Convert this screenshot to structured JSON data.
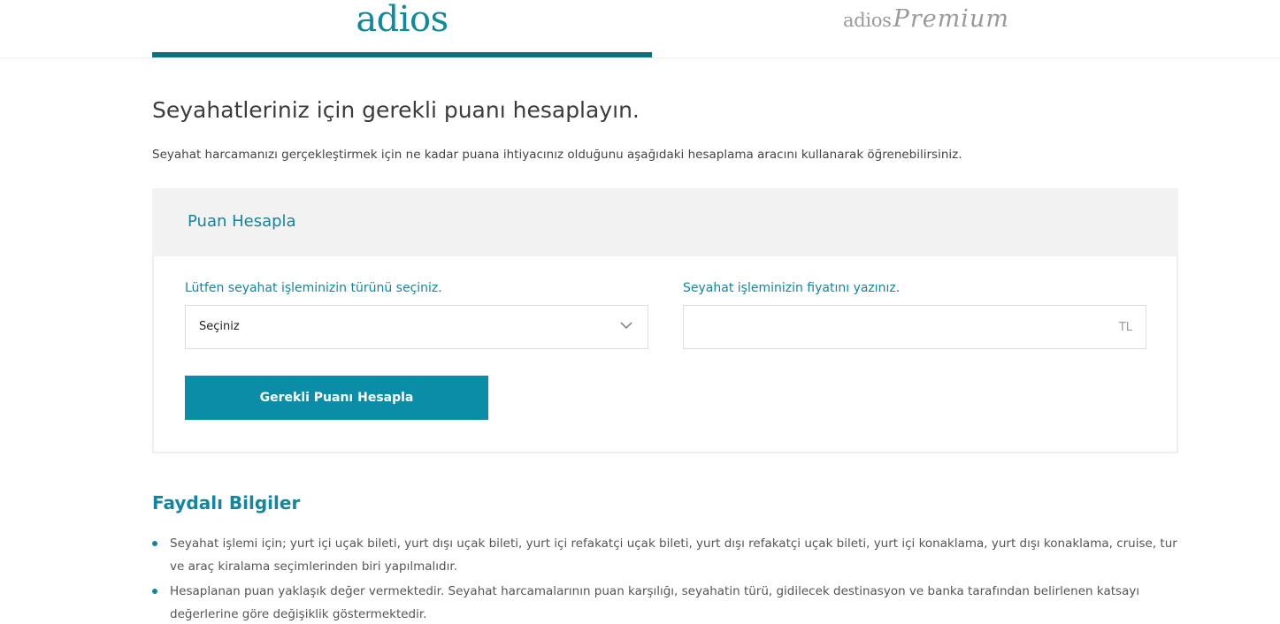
{
  "header": {
    "tabs": [
      {
        "label": "adios",
        "active": true
      },
      {
        "label_part1": "adios",
        "label_part2": "Premium",
        "active": false
      }
    ],
    "accent_color": "#0f6f7c"
  },
  "intro": {
    "title": "Seyahatleriniz için gerekli puanı hesaplayın.",
    "description": "Seyahat harcamanızı gerçekleştirmek için ne kadar puana ihtiyacınız olduğunu aşağıdaki hesaplama aracını kullanarak öğrenebilirsiniz."
  },
  "calculator": {
    "title": "Puan Hesapla",
    "type_label": "Lütfen seyahat işleminizin türünü seçiniz.",
    "type_select_value": "Seçiniz",
    "price_label": "Seyahat işleminizin fiyatını yazınız.",
    "price_value": "",
    "price_currency": "TL",
    "button_label": "Gerekli Puanı Hesapla",
    "button_color": "#0a8ea8"
  },
  "info": {
    "title": "Faydalı Bilgiler",
    "items": [
      "Seyahat işlemi için; yurt içi uçak bileti, yurt dışı uçak bileti, yurt içi refakatçi uçak bileti, yurt dışı refakatçi uçak bileti, yurt içi konaklama, yurt dışı konaklama, cruise, tur ve araç kiralama seçimlerinden biri yapılmalıdır.",
      "Hesaplanan puan yaklaşık değer vermektedir. Seyahat harcamalarının puan karşılığı, seyahatin türü, gidilecek destinasyon ve banka tarafından belirlenen katsayı değerlerine göre değişiklik göstermektedir."
    ]
  }
}
